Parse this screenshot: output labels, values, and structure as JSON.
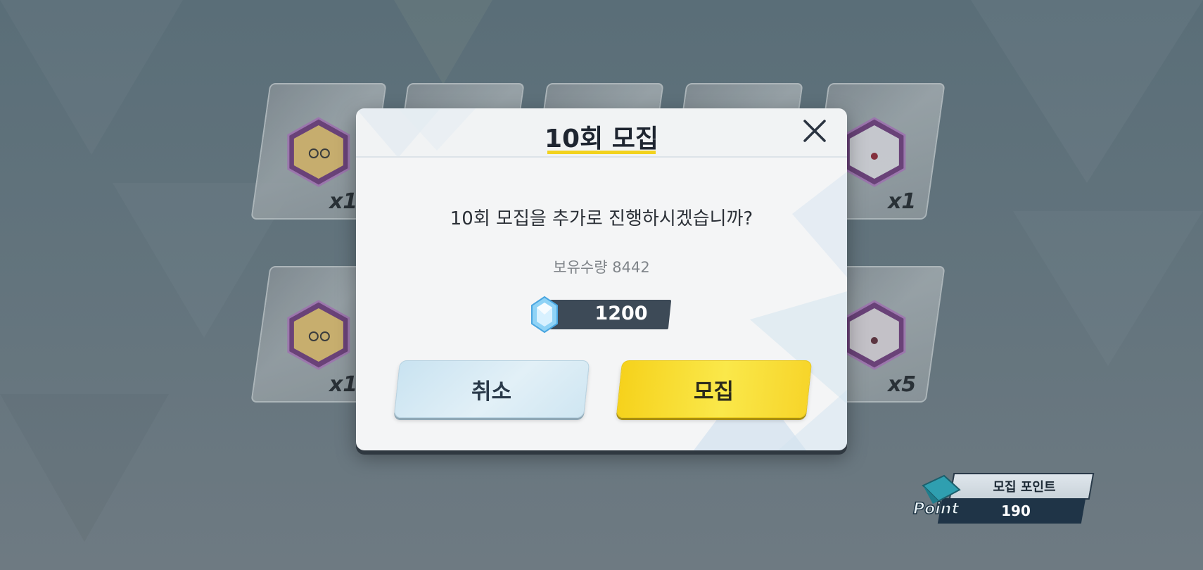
{
  "background_cards": [
    {
      "count": "x1",
      "portrait": "blonde-glasses-character-icon",
      "visible": true
    },
    {
      "count": "",
      "portrait": "",
      "visible": true
    },
    {
      "count": "",
      "portrait": "",
      "visible": true
    },
    {
      "count": "",
      "portrait": "",
      "visible": true
    },
    {
      "count": "x1",
      "portrait": "white-hair-character-icon",
      "visible": true
    },
    {
      "count": "x1",
      "portrait": "blonde-glasses-character-icon",
      "visible": true
    },
    {
      "count": "x5",
      "portrait": "white-hair-character-icon",
      "visible": true
    }
  ],
  "dialog": {
    "title": "10회 모집",
    "question": "10회 모집을 추가로 진행하시겠습니까?",
    "owned_label": "보유수량 8442",
    "cost": "1200",
    "cost_icon": "crystal-gem-icon",
    "cancel_label": "취소",
    "confirm_label": "모집",
    "close_icon": "close-icon"
  },
  "point_panel": {
    "label": "모집 포인트",
    "value": "190",
    "icon_text": "Point",
    "icon": "envelope-point-icon"
  },
  "colors": {
    "accent_yellow": "#f6d21c",
    "cancel_blue": "#cfe6f2",
    "dark_bar": "#3d4a57",
    "overlay": "#5a6e78"
  }
}
